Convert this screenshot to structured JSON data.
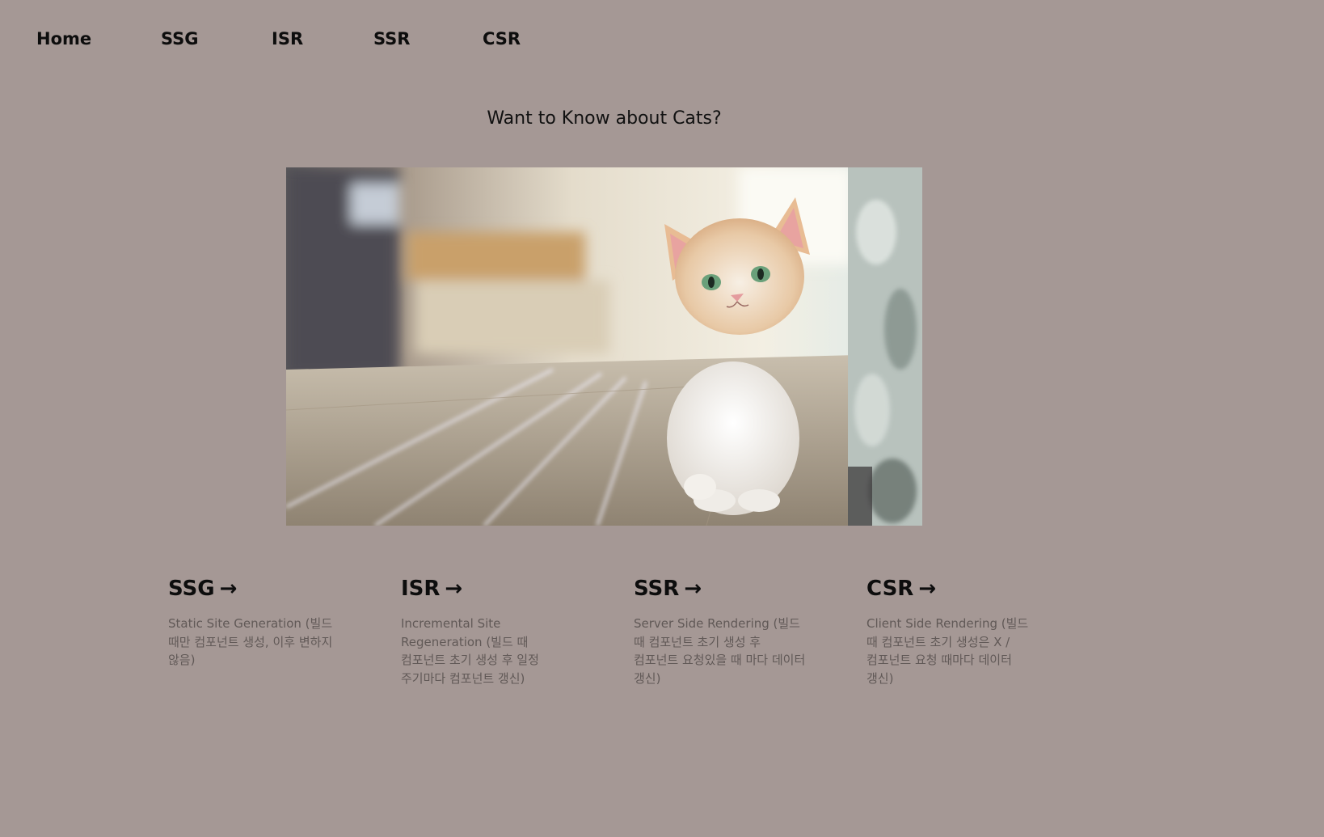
{
  "nav": {
    "items": [
      {
        "label": "Home"
      },
      {
        "label": "SSG"
      },
      {
        "label": "ISR"
      },
      {
        "label": "SSR"
      },
      {
        "label": "CSR"
      }
    ]
  },
  "hero": {
    "headline": "Want to Know about Cats?"
  },
  "cards": [
    {
      "title": "SSG",
      "arrow": "→",
      "description": "Static Site Generation (빌드 때만 컴포넌트 생성, 이후 변하지 않음)"
    },
    {
      "title": "ISR",
      "arrow": "→",
      "description": "Incremental Site Regeneration (빌드 때 컴포넌트 초기 생성 후 일정 주기마다 컴포넌트 갱신)"
    },
    {
      "title": "SSR",
      "arrow": "→",
      "description": "Server Side Rendering (빌드 때 컴포넌트 초기 생성 후 컴포넌트 요청있을 때 마다 데이터 갱신)"
    },
    {
      "title": "CSR",
      "arrow": "→",
      "description": "Client Side Rendering (빌드 때 컴포넌트 초기 생성은 X / 컴포넌트 요청 때마다 데이터 갱신)"
    }
  ],
  "colors": {
    "background": "#a59895",
    "text": "#0d0d0d",
    "muted_text": "#615957"
  }
}
